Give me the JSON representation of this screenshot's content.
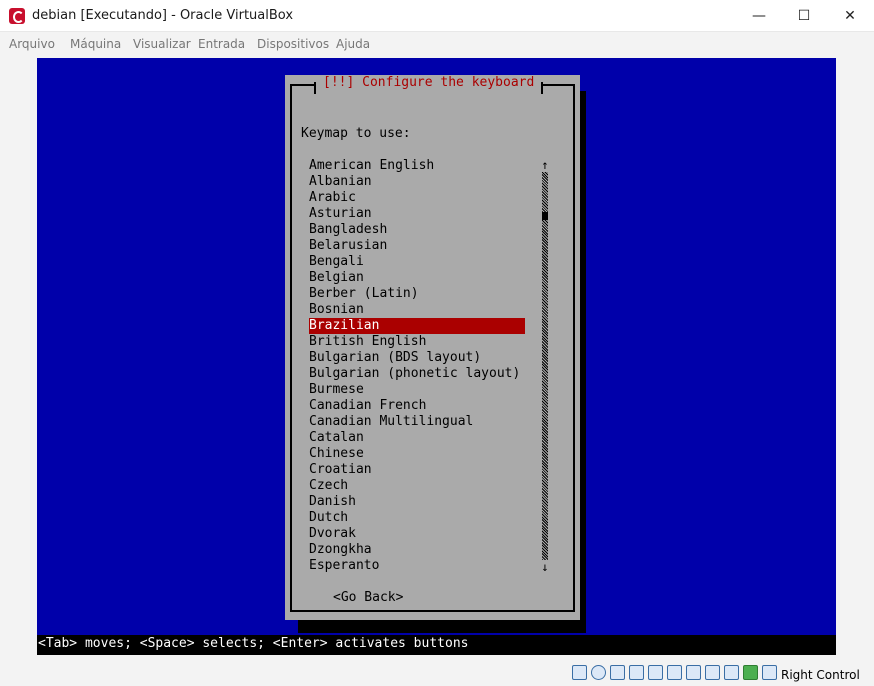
{
  "window": {
    "title": "debian [Executando] - Oracle VirtualBox",
    "minimize": "—",
    "maximize": "☐",
    "close": "✕"
  },
  "menu": [
    "Arquivo",
    "Máquina",
    "Visualizar",
    "Entrada",
    "Dispositivos",
    "Ajuda"
  ],
  "installer": {
    "dialog_title": "[!!] Configure the keyboard",
    "prompt": "Keymap to use:",
    "keymaps": [
      "American English",
      "Albanian",
      "Arabic",
      "Asturian",
      "Bangladesh",
      "Belarusian",
      "Bengali",
      "Belgian",
      "Berber (Latin)",
      "Bosnian",
      "Brazilian",
      "British English",
      "Bulgarian (BDS layout)",
      "Bulgarian (phonetic layout)",
      "Burmese",
      "Canadian French",
      "Canadian Multilingual",
      "Catalan",
      "Chinese",
      "Croatian",
      "Czech",
      "Danish",
      "Dutch",
      "Dvorak",
      "Dzongkha",
      "Esperanto"
    ],
    "selected": "Brazilian",
    "scroll_up": "↑",
    "scroll_down": "↓",
    "go_back": "<Go Back>",
    "help_line": "<Tab> moves; <Space> selects; <Enter> activates buttons"
  },
  "statusbar": {
    "icons": [
      "hard-disk-icon",
      "optical-drive-icon",
      "audio-icon",
      "network-icon",
      "usb-icon",
      "shared-folder-icon",
      "display-icon",
      "recording-icon",
      "cpu-icon",
      "mouse-integration-icon",
      "keyboard-icon"
    ],
    "host_key": "Right Control"
  },
  "colors": {
    "screen_bg": "#0000aa",
    "dialog_bg": "#aaaaaa",
    "title_red": "#aa0000",
    "selection_bg": "#aa0000"
  }
}
